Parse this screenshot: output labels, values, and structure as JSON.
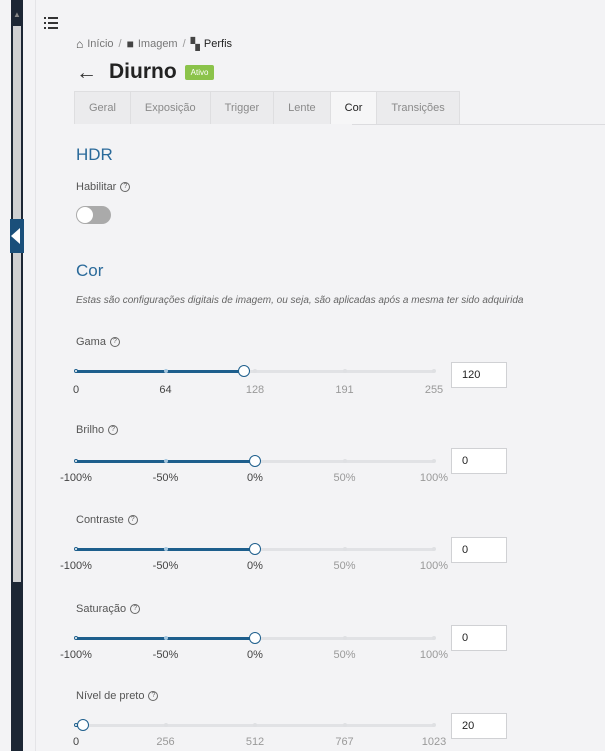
{
  "breadcrumb": {
    "home": "Início",
    "image": "Imagem",
    "current": "Perfis"
  },
  "page": {
    "title": "Diurno",
    "status_badge": "Ativo"
  },
  "tabs": [
    "Geral",
    "Exposição",
    "Trigger",
    "Lente",
    "Cor",
    "Transições"
  ],
  "active_tab": "Cor",
  "hdr": {
    "heading": "HDR",
    "enable_label": "Habilitar",
    "enabled": false
  },
  "cor": {
    "heading": "Cor",
    "description": "Estas são configurações digitais de imagem, ou seja, são aplicadas após a mesma ter sido adquirida"
  },
  "sliders": [
    {
      "label": "Gama",
      "value": "120",
      "fraction": 0.47,
      "marks": [
        "0",
        "64",
        "128",
        "191",
        "255"
      ]
    },
    {
      "label": "Brilho",
      "value": "0",
      "fraction": 0.5,
      "marks": [
        "-100%",
        "-50%",
        "0%",
        "50%",
        "100%"
      ]
    },
    {
      "label": "Contraste",
      "value": "0",
      "fraction": 0.5,
      "marks": [
        "-100%",
        "-50%",
        "0%",
        "50%",
        "100%"
      ]
    },
    {
      "label": "Saturação",
      "value": "0",
      "fraction": 0.5,
      "marks": [
        "-100%",
        "-50%",
        "0%",
        "50%",
        "100%"
      ]
    },
    {
      "label": "Nível de preto",
      "value": "20",
      "fraction": 0.02,
      "marks": [
        "0",
        "256",
        "512",
        "767",
        "1023"
      ]
    }
  ],
  "colors": {
    "accent": "#1d5e8c",
    "heading": "#2a6a9a",
    "badge": "#8bc34a",
    "sidebar": "#1c2634"
  }
}
